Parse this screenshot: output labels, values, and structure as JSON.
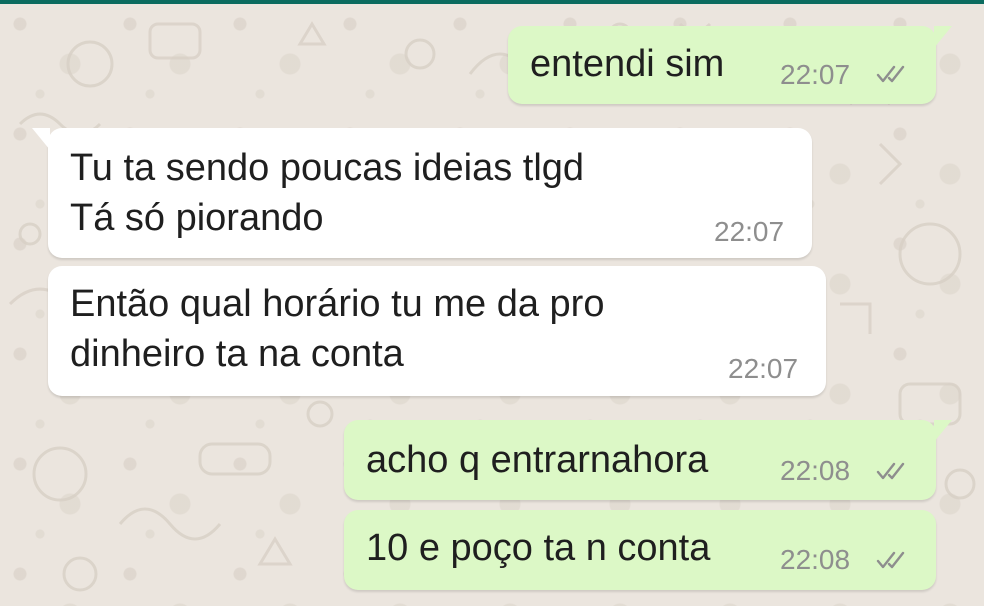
{
  "chat": {
    "messages": [
      {
        "direction": "outgoing",
        "lines": [
          "entendi sim"
        ],
        "time": "22:07",
        "status_icon": "double-check-icon"
      },
      {
        "direction": "incoming",
        "lines": [
          "Tu ta sendo poucas ideias tlgd",
          "Tá só piorando"
        ],
        "time": "22:07"
      },
      {
        "direction": "incoming",
        "lines": [
          "Então qual horário tu me da pro",
          "dinheiro ta na conta"
        ],
        "time": "22:07"
      },
      {
        "direction": "outgoing",
        "lines": [
          "acho q entrarnahora"
        ],
        "time": "22:08",
        "status_icon": "double-check-icon"
      },
      {
        "direction": "outgoing",
        "lines": [
          "10 e poço ta n conta"
        ],
        "time": "22:08",
        "status_icon": "double-check-icon"
      }
    ]
  },
  "colors": {
    "outgoing_bubble": "#dcf8c6",
    "incoming_bubble": "#ffffff",
    "wallpaper": "#ebe5de",
    "timestamp": "#8e8e8e",
    "tick_color": "#8e8e8e",
    "header_accent": "#0b6b5f"
  }
}
